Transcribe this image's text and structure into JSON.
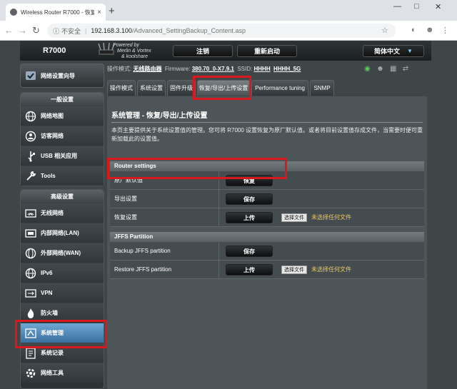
{
  "browser": {
    "tab_title": "Wireless Router R7000 - 恢复/",
    "tab_close": "×",
    "new_tab": "+",
    "url_secure": "不安全",
    "url_host": "192.168.3.100",
    "url_path": "/Advanced_SettingBackup_Content.asp"
  },
  "header": {
    "model": "R7000",
    "powered_line1": "Powered by",
    "powered_line2": "Merlin & Vortex",
    "powered_line3": "& koolshare",
    "logout_label": "注销",
    "reboot_label": "重新启动",
    "language_label": "简体中文"
  },
  "status": {
    "mode_label": "操作模式:",
    "mode_value": "无线路由器",
    "firmware_label": "Firmware:",
    "firmware_value": "380.70_0-X7.9.1",
    "ssid_label": "SSID:",
    "ssid_value1": "HHHH",
    "ssid_value2": "HHHH_5G"
  },
  "sidebar": {
    "qis_label": "网络设置向导",
    "general_head": "一般设置",
    "general_items": [
      {
        "label": "网络地图",
        "icon": "globe-icon"
      },
      {
        "label": "访客网络",
        "icon": "guest-network-icon"
      },
      {
        "label": "USB 相关应用",
        "icon": "usb-icon"
      },
      {
        "label": "Tools",
        "icon": "wrench-icon"
      }
    ],
    "advanced_head": "高级设置",
    "advanced_items": [
      {
        "label": "无线网络",
        "icon": "wireless-icon"
      },
      {
        "label": "内部网络(LAN)",
        "icon": "lan-icon"
      },
      {
        "label": "外部网络(WAN)",
        "icon": "wan-globe-icon"
      },
      {
        "label": "IPv6",
        "icon": "ipv6-globe-icon"
      },
      {
        "label": "VPN",
        "icon": "vpn-icon"
      },
      {
        "label": "防火墙",
        "icon": "firewall-icon"
      },
      {
        "label": "系统管理",
        "icon": "administration-icon"
      },
      {
        "label": "系统记录",
        "icon": "system-log-icon"
      },
      {
        "label": "网络工具",
        "icon": "network-tools-icon"
      }
    ]
  },
  "tabs": [
    "操作模式",
    "系统设置",
    "固件升级",
    "恢复/导出/上传设置",
    "Performance tuning",
    "SNMP"
  ],
  "panel": {
    "title": "系统管理 - 恢复/导出/上传设置",
    "description": "本页主要提供关于系统设置值的管理。您可将 R7000 设置恢复为原厂默认值。或者将目前设置值存成文件，当需要时便可重新加载此的设置值。",
    "router_settings_head": "Router settings",
    "factory_default_label": "原厂默认值",
    "restore_button": "恢复",
    "save_setting_label": "导出设置",
    "save_button": "保存",
    "restore_setting_label": "恢复设置",
    "upload_button": "上传",
    "choose_file": "选择文件",
    "no_file": "未选择任何文件",
    "jffs_head": "JFFS Partition",
    "backup_jffs_label": "Backup JFFS partition",
    "backup_jffs_button": "保存",
    "restore_jffs_label": "Restore JFFS partition",
    "restore_jffs_button": "上传",
    "jffs_choose_file": "选择文件",
    "jffs_no_file": "未选择任何文件"
  },
  "colors": {
    "highlight": "#d9181b",
    "active_item": "#4f86b6",
    "no_file_text": "#f0c85a"
  }
}
